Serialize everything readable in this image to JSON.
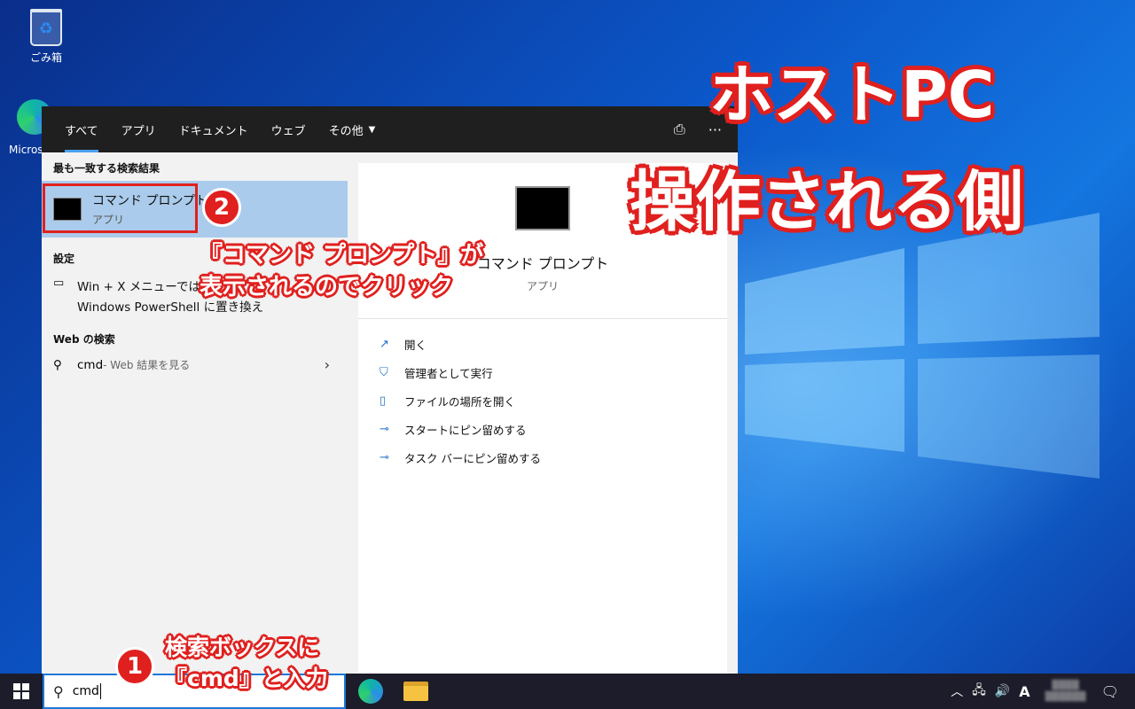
{
  "desktop": {
    "icons": [
      {
        "label": "ごみ箱"
      },
      {
        "label": "Micros"
      }
    ]
  },
  "start_menu": {
    "tabs": [
      "すべて",
      "アプリ",
      "ドキュメント",
      "ウェブ",
      "その他"
    ],
    "best_match_heading": "最も一致する検索結果",
    "best_match": {
      "title": "コマンド プロンプト",
      "subtitle": "アプリ"
    },
    "settings_heading": "設定",
    "settings_item": {
      "line1": "Win + X メニューではコマ",
      "line2": "Windows PowerShell に置き換え"
    },
    "web_heading": "Web の検索",
    "web_item": {
      "query": "cmd",
      "suffix": " - Web 結果を見る"
    },
    "preview": {
      "title": "コマンド プロンプト",
      "subtitle": "アプリ"
    },
    "actions": [
      "開く",
      "管理者として実行",
      "ファイルの場所を開く",
      "スタートにピン留めする",
      "タスク バーにピン留めする"
    ]
  },
  "taskbar": {
    "search_value": "cmd",
    "ime": "A"
  },
  "annotations": {
    "title_line1": "ホストPC",
    "title_line2": "操作される側",
    "note2_line1": "『コマンド プロンプト』が",
    "note2_line2": "表示されるのでクリック",
    "note1_line1": "検索ボックスに",
    "note1_line2": "『cmd』と入力",
    "badge1": "1",
    "badge2": "2"
  }
}
